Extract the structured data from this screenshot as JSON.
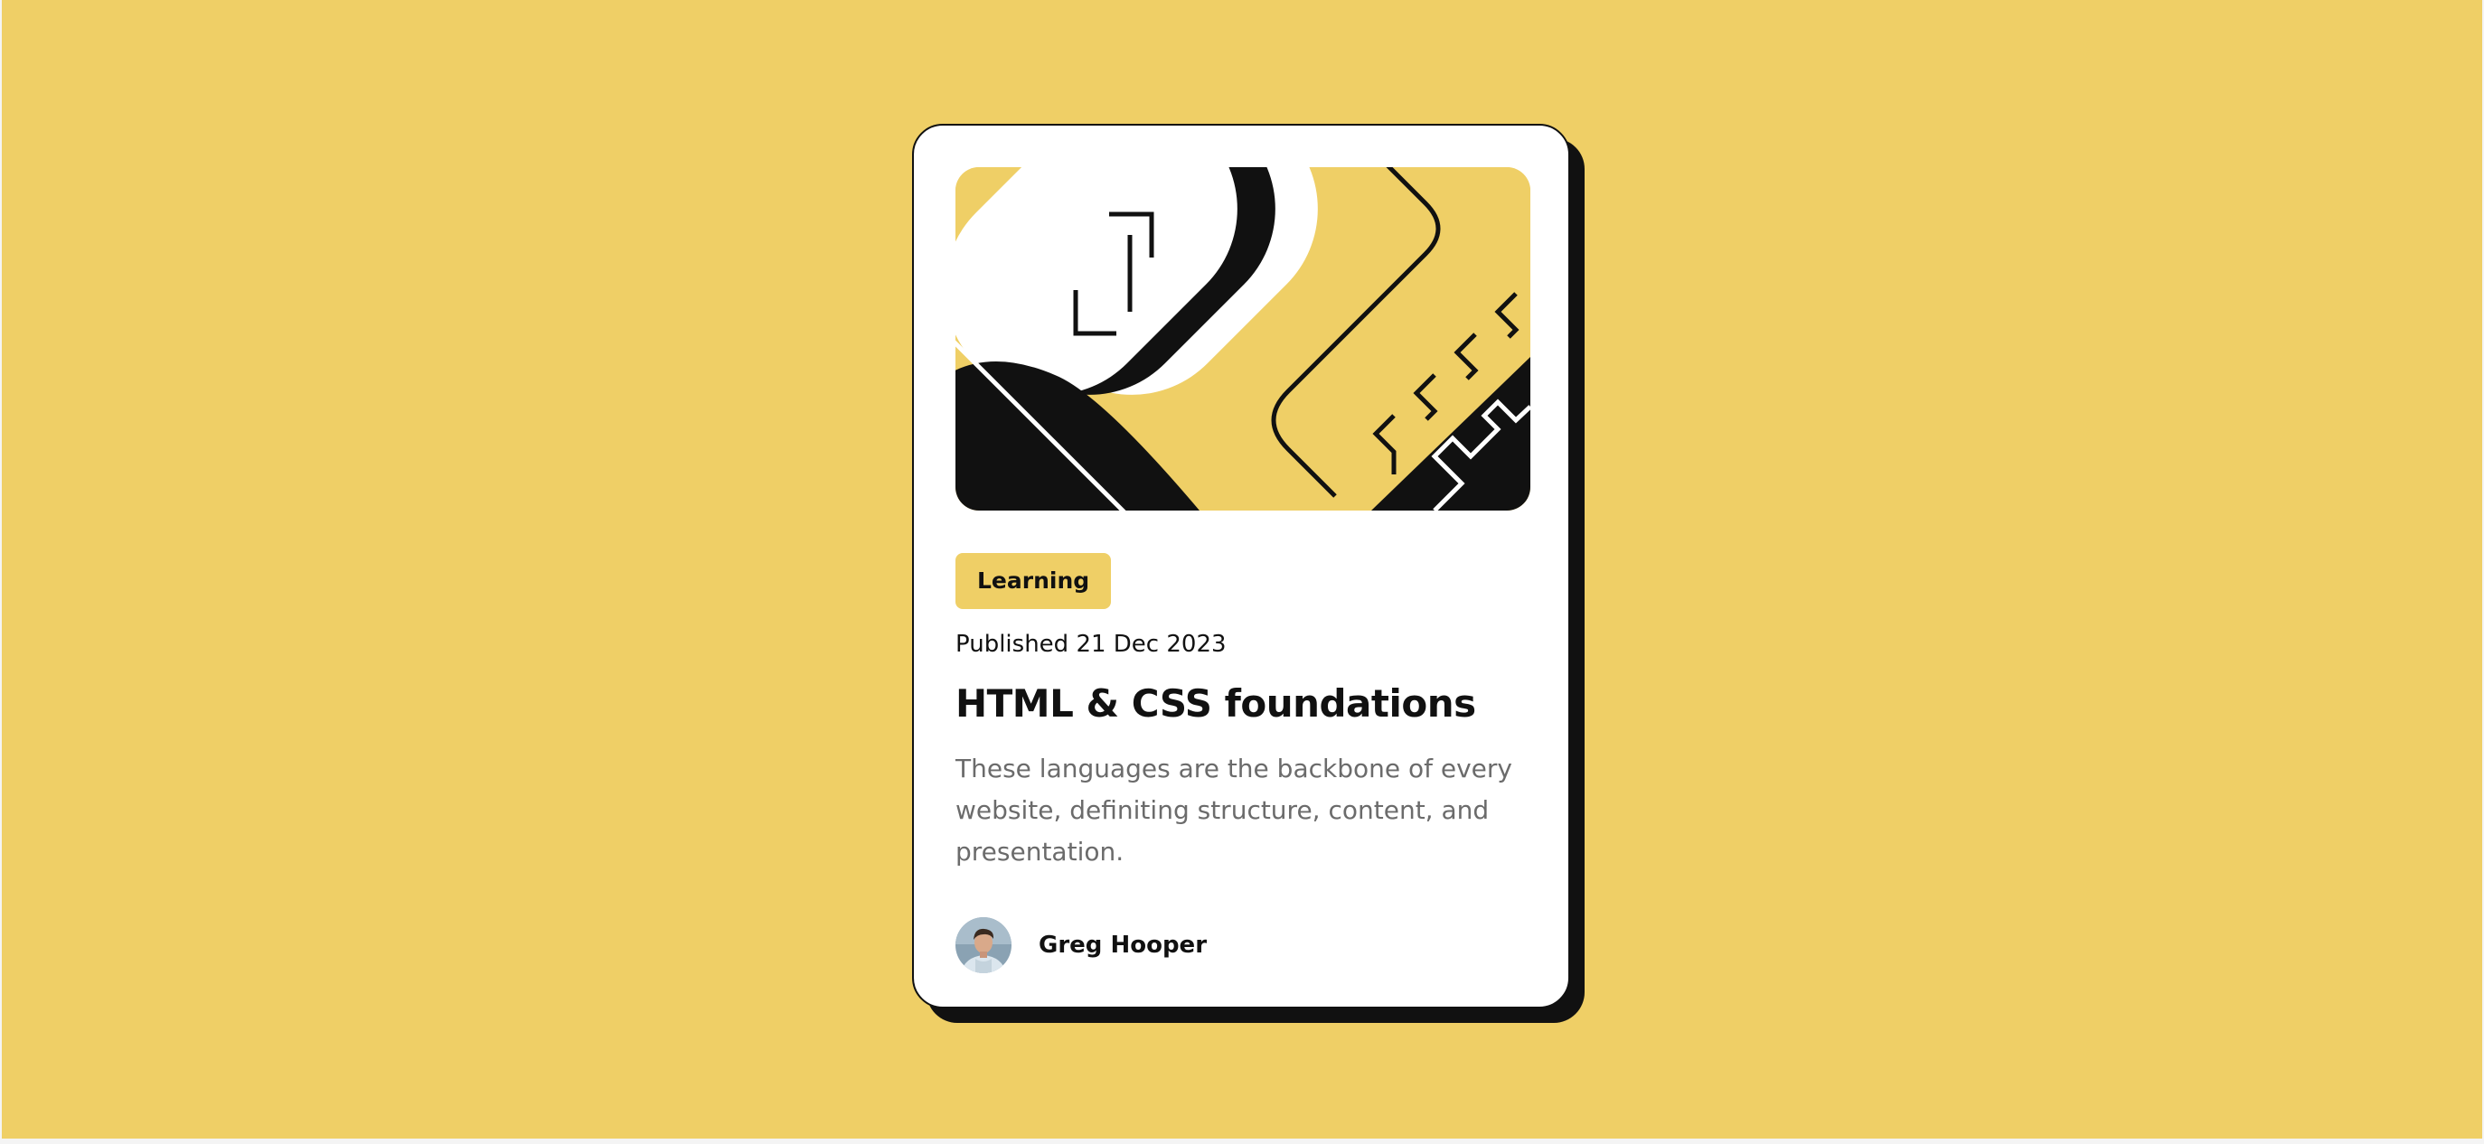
{
  "card": {
    "image_alt": "Abstract geometric illustration",
    "tag": "Learning",
    "published": "Published 21 Dec 2023",
    "title": "HTML & CSS foundations",
    "description": "These languages are the backbone of every website, definiting structure, content, and presentation.",
    "author": {
      "name": "Greg Hooper",
      "avatar": "author-avatar"
    }
  },
  "colors": {
    "background": "#EFCF66",
    "card": "#FFFFFF",
    "ink": "#111111",
    "muted_text": "#6B6B6B"
  }
}
